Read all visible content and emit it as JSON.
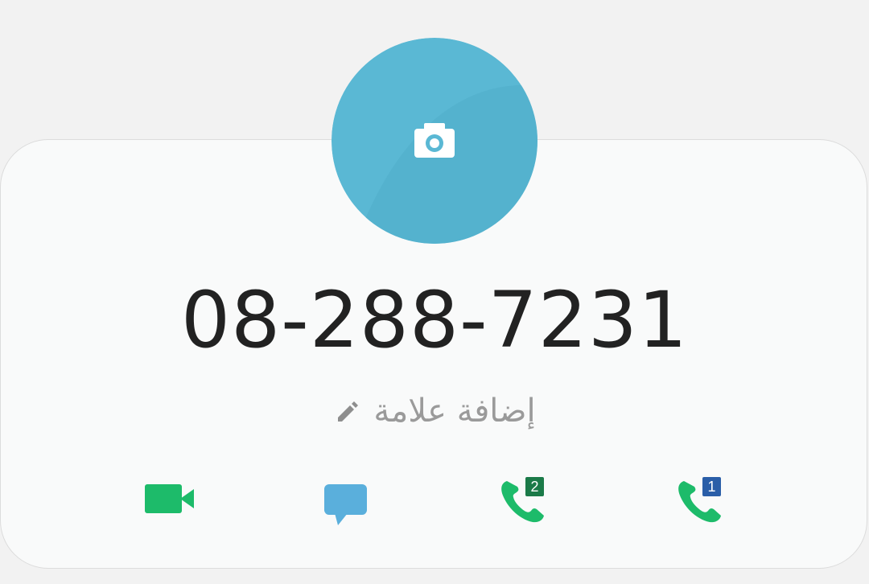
{
  "contact": {
    "phone_number": "08-288-7231",
    "add_tag_label": "إضافة علامة"
  },
  "avatar": {
    "icon": "camera-icon",
    "color": "#5ab8d4"
  },
  "actions": {
    "video_call": {
      "icon": "video-camera-icon",
      "color": "#1dbb6a"
    },
    "message": {
      "icon": "chat-bubble-icon",
      "color": "#5aafdc"
    },
    "call_sim2": {
      "icon": "phone-icon",
      "sim_label": "2",
      "color": "#1dbb6a",
      "badge_color": "#1b7a48"
    },
    "call_sim1": {
      "icon": "phone-icon",
      "sim_label": "1",
      "color": "#1dbb6a",
      "badge_color": "#2a5ea8"
    }
  }
}
